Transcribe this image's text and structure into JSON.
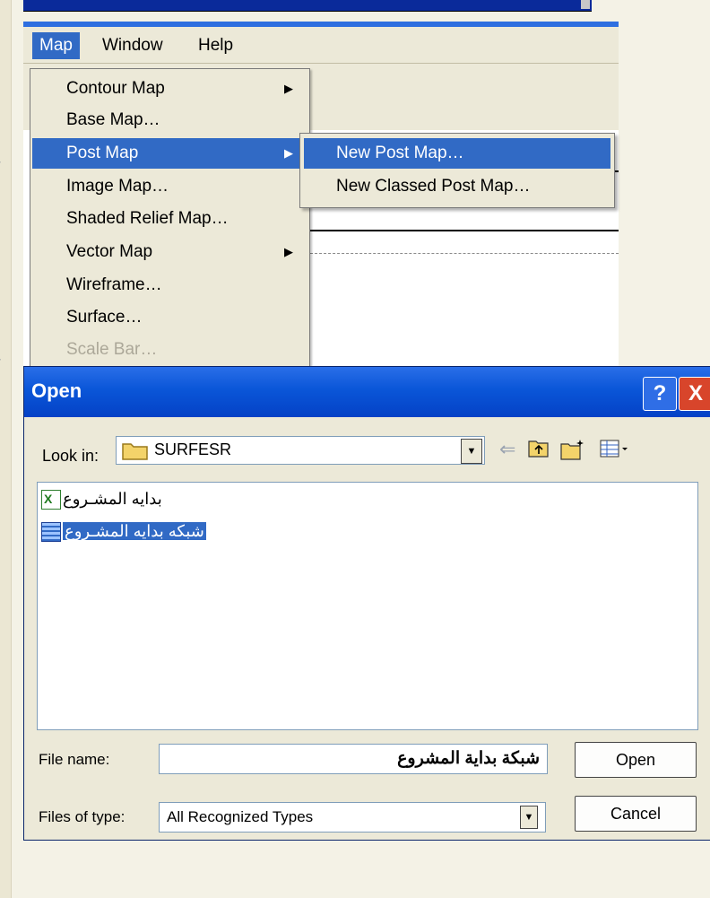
{
  "menubar": {
    "items": [
      "Map",
      "Window",
      "Help"
    ]
  },
  "map_menu": {
    "items": [
      {
        "label": "Contour Map"
      },
      {
        "label": "Base Map…"
      },
      {
        "label": "Post Map"
      },
      {
        "label": "Image Map…"
      },
      {
        "label": "Shaded Relief Map…"
      },
      {
        "label": "Vector Map"
      },
      {
        "label": "Wireframe…"
      },
      {
        "label": "Surface…"
      },
      {
        "label": "Scale Bar…"
      }
    ]
  },
  "submenu": {
    "items": [
      "New Post Map…",
      "New Classed Post Map…"
    ]
  },
  "dialog": {
    "title": "Open",
    "help_glyph": "?",
    "close_glyph": "X",
    "look_in_label": "Look in:",
    "look_in_value": "SURFESR",
    "files": [
      "بدايه المشـروع",
      "شبكه بدايه المشـروع"
    ],
    "file_name_label": "File name:",
    "file_name_value": "شبكة بداية المشروع",
    "files_of_type_label": "Files of type:",
    "files_of_type_value": "All Recognized Types",
    "open_button": "Open",
    "cancel_button": "Cancel"
  }
}
